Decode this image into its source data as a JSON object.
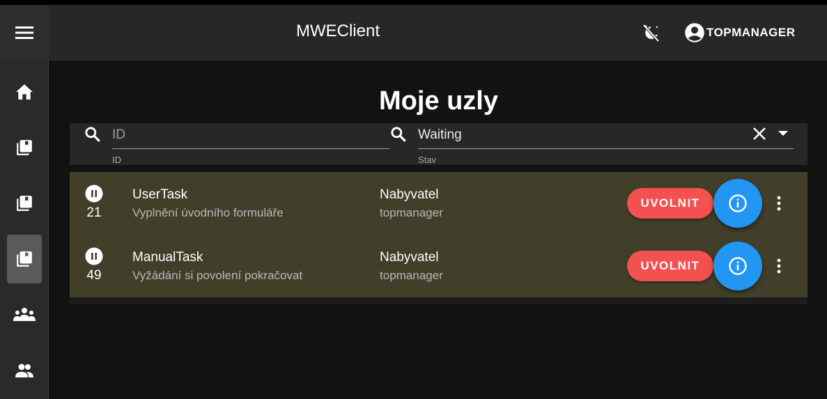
{
  "header": {
    "title": "MWEClient",
    "user_label": "TOPMANAGER",
    "menu_icon": "menu-icon",
    "theme_icon": "theme-toggle-icon",
    "user_icon": "account-circle-icon"
  },
  "sidebar": {
    "items": [
      {
        "icon": "home-icon"
      },
      {
        "icon": "library-books-icon"
      },
      {
        "icon": "library-books-icon"
      },
      {
        "icon": "library-books-icon",
        "active": true
      },
      {
        "icon": "groups-icon"
      },
      {
        "icon": "people-icon"
      }
    ]
  },
  "page": {
    "title": "Moje uzly"
  },
  "filters": {
    "id": {
      "placeholder": "ID",
      "label": "ID",
      "value": ""
    },
    "state": {
      "value": "Waiting",
      "label": "Stav"
    }
  },
  "rows": [
    {
      "state_icon": "pause-circle-icon",
      "number": "21",
      "task_name": "UserTask",
      "task_desc": "Vyplnění úvodního formuláře",
      "role": "Nabyvatel",
      "user": "topmanager",
      "release_label": "UVOLNIT"
    },
    {
      "state_icon": "pause-circle-icon",
      "number": "49",
      "task_name": "ManualTask",
      "task_desc": "Vyžádání si povolení pokračovat",
      "role": "Nabyvatel",
      "user": "topmanager",
      "release_label": "UVOLNIT"
    }
  ],
  "colors": {
    "background": "#121212",
    "appbar": "#272727",
    "row_background": "#413f2a",
    "release_button": "#f35050",
    "info_button": "#2196f3"
  }
}
